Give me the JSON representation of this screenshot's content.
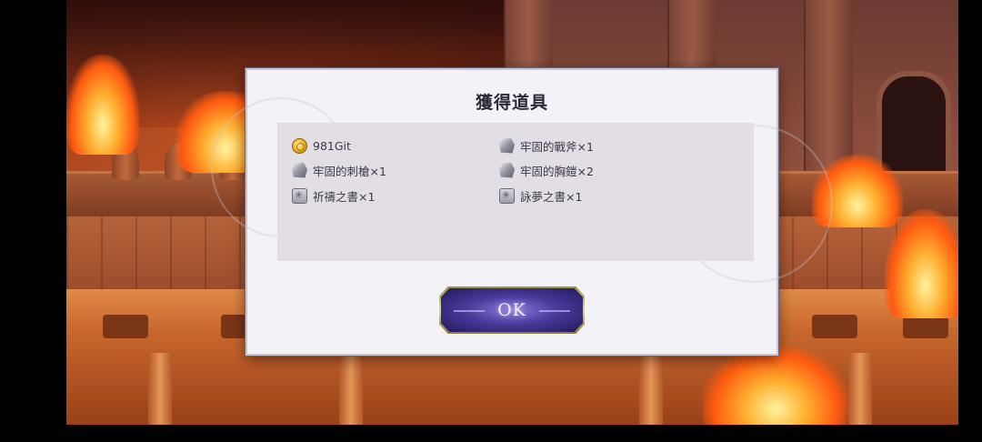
{
  "dialog": {
    "title": "獲得道具",
    "ok_label": "OK"
  },
  "rewards": {
    "left": [
      {
        "label": "981Git",
        "icon": "gold-coin-icon"
      },
      {
        "label": "牢固的刺槍×1",
        "icon": "ore-icon"
      },
      {
        "label": "祈禱之書×1",
        "icon": "book-icon"
      }
    ],
    "right": [
      {
        "label": "牢固的戰斧×1",
        "icon": "ore-icon"
      },
      {
        "label": "牢固的胸鎧×2",
        "icon": "ore-icon"
      },
      {
        "label": "詠夢之書×1",
        "icon": "book-icon"
      }
    ]
  },
  "colors": {
    "dialog_bg": "#f3f2f7",
    "panel_bg": "#e3dde4",
    "button_accent": "#4a3a9c",
    "button_border": "#e6d696"
  }
}
